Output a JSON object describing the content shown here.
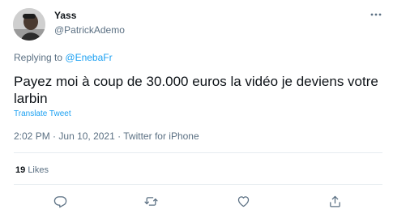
{
  "author": {
    "name": "Yass",
    "handle": "@PatrickAdemo"
  },
  "reply": {
    "prefix": "Replying to",
    "mention": "@EnebaFr"
  },
  "tweet": {
    "text": "Payez moi à coup de 30.000 euros la vidéo je deviens votre larbin",
    "translate_label": "Translate Tweet",
    "time": "2:02 PM",
    "date": "Jun 10, 2021",
    "source": "Twitter for iPhone"
  },
  "stats": {
    "likes_count": "19",
    "likes_label": "Likes"
  },
  "icons": {
    "more": "more-horizontal-icon",
    "reply": "reply-icon",
    "retweet": "retweet-icon",
    "like": "heart-icon",
    "share": "share-icon"
  },
  "colors": {
    "accent": "#1da1f2",
    "secondary_text": "#5b7083",
    "primary_text": "#0f1419",
    "divider": "#e6ecf0"
  }
}
